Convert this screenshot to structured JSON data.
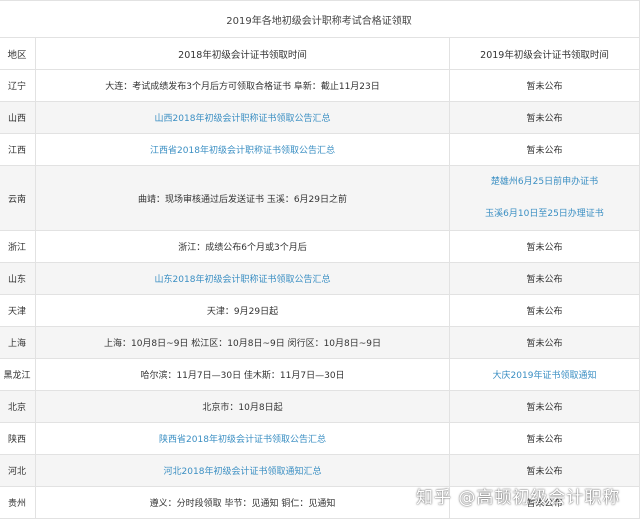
{
  "title": "2019年各地初级会计职称考试合格证领取",
  "columns": [
    "地区",
    "2018年初级会计证书领取时间",
    "2019年初级会计证书领取时间"
  ],
  "rows": [
    {
      "region": "辽宁",
      "y2018": {
        "text": "大连：考试成绩发布3个月后方可领取合格证书 阜新：截止11月23日",
        "link": false
      },
      "y2019": [
        {
          "text": "暂未公布",
          "link": false
        }
      ]
    },
    {
      "region": "山西",
      "y2018": {
        "text": "山西2018年初级会计职称证书领取公告汇总",
        "link": true
      },
      "y2019": [
        {
          "text": "暂未公布",
          "link": false
        }
      ]
    },
    {
      "region": "江西",
      "y2018": {
        "text": "江西省2018年初级会计职称证书领取公告汇总",
        "link": true
      },
      "y2019": [
        {
          "text": "暂未公布",
          "link": false
        }
      ]
    },
    {
      "region": "云南",
      "y2018": {
        "text": "曲靖：现场审核通过后发送证书 玉溪：6月29日之前",
        "link": false
      },
      "y2019": [
        {
          "text": "楚雄州6月25日前申办证书",
          "link": true
        },
        {
          "text": "玉溪6月10日至25日办理证书",
          "link": true
        }
      ]
    },
    {
      "region": "浙江",
      "y2018": {
        "text": "浙江：成绩公布6个月或3个月后",
        "link": false
      },
      "y2019": [
        {
          "text": "暂未公布",
          "link": false
        }
      ]
    },
    {
      "region": "山东",
      "y2018": {
        "text": "山东2018年初级会计职称证书领取公告汇总",
        "link": true
      },
      "y2019": [
        {
          "text": "暂未公布",
          "link": false
        }
      ]
    },
    {
      "region": "天津",
      "y2018": {
        "text": "天津：9月29日起",
        "link": false
      },
      "y2019": [
        {
          "text": "暂未公布",
          "link": false
        }
      ]
    },
    {
      "region": "上海",
      "y2018": {
        "text": "上海：10月8日~9日 松江区：10月8日~9日 闵行区：10月8日~9日",
        "link": false
      },
      "y2019": [
        {
          "text": "暂未公布",
          "link": false
        }
      ]
    },
    {
      "region": "黑龙江",
      "y2018": {
        "text": "哈尔滨：11月7日—30日 佳木斯：11月7日—30日",
        "link": false
      },
      "y2019": [
        {
          "text": "大庆2019年证书领取通知",
          "link": true
        }
      ]
    },
    {
      "region": "北京",
      "y2018": {
        "text": "北京市：10月8日起",
        "link": false
      },
      "y2019": [
        {
          "text": "暂未公布",
          "link": false
        }
      ]
    },
    {
      "region": "陕西",
      "y2018": {
        "text": "陕西省2018年初级会计证书领取公告汇总",
        "link": true
      },
      "y2019": [
        {
          "text": "暂未公布",
          "link": false
        }
      ]
    },
    {
      "region": "河北",
      "y2018": {
        "text": "河北2018年初级会计证书领取通知汇总",
        "link": true
      },
      "y2019": [
        {
          "text": "暂未公布",
          "link": false
        }
      ]
    },
    {
      "region": "贵州",
      "y2018": {
        "text": "遵义：分时段领取 毕节：见通知 铜仁：见通知",
        "link": false
      },
      "y2019": [
        {
          "text": "暂未公布",
          "link": false
        }
      ]
    }
  ],
  "watermark": "知乎 @高顿初级会计职称",
  "colors": {
    "link": "#3b8fc3",
    "text": "#333333",
    "border": "#e2e2e2",
    "stripe": "#f5f5f5"
  }
}
